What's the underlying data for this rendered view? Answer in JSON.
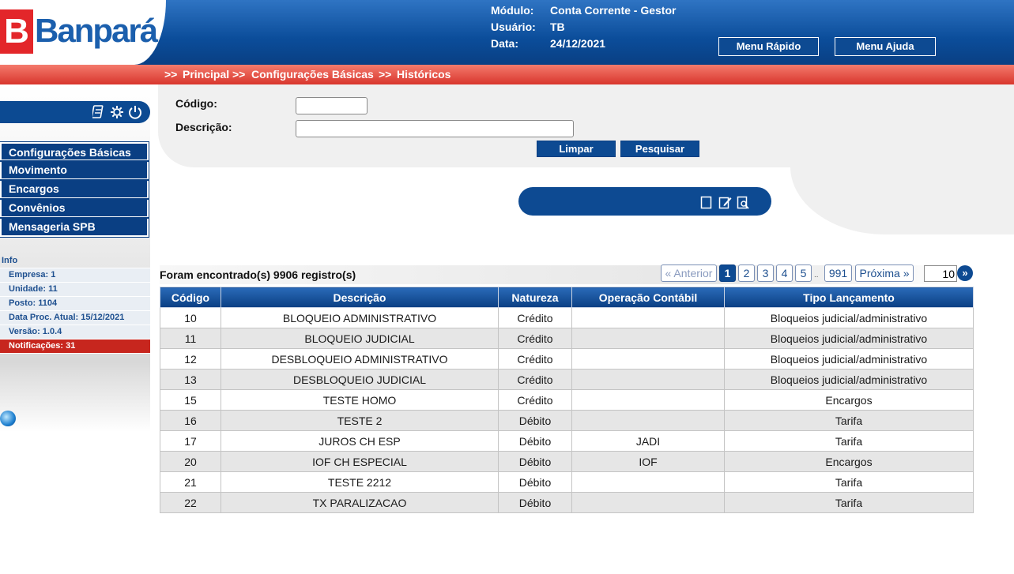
{
  "header": {
    "logo_text": "Banpará",
    "logo_mark": "B",
    "modulo_label": "Módulo:",
    "modulo_value": "Conta Corrente - Gestor",
    "usuario_label": "Usuário:",
    "usuario_value": "TB",
    "data_label": "Data:",
    "data_value": "24/12/2021",
    "menu_rapido": "Menu Rápido",
    "menu_ajuda": "Menu Ajuda"
  },
  "breadcrumb": {
    "sep": ">>",
    "items": [
      "Principal",
      "Configurações Básicas",
      "Históricos"
    ]
  },
  "sidebar": {
    "tools": [
      "calculator-icon",
      "gear-icon",
      "power-icon"
    ],
    "menu": [
      "Configurações Básicas",
      "Movimento",
      "Encargos",
      "Convênios",
      "Mensageria SPB"
    ],
    "info_title": "Info",
    "info": {
      "empresa": "Empresa: 1",
      "unidade": "Unidade: 11",
      "posto": "Posto: 1104",
      "data_proc": "Data Proc. Atual: 15/12/2021",
      "versao": "Versão: 1.0.4",
      "notificacoes": "Notificações: 31"
    }
  },
  "search": {
    "codigo_label": "Código:",
    "codigo_value": "",
    "descricao_label": "Descrição:",
    "descricao_value": "",
    "limpar": "Limpar",
    "pesquisar": "Pesquisar"
  },
  "actions": [
    "new-icon",
    "edit-icon",
    "view-icon"
  ],
  "results": {
    "count_text": "Foram encontrado(s) 9906 registro(s)",
    "pagination": {
      "prev": "« Anterior",
      "pages": [
        "1",
        "2",
        "3",
        "4",
        "5"
      ],
      "dots": "..",
      "last": "991",
      "next": "Próxima »",
      "current": "1",
      "page_size": "10",
      "go": "»"
    }
  },
  "table": {
    "headers": [
      "Código",
      "Descrição",
      "Natureza",
      "Operação Contábil",
      "Tipo Lançamento"
    ],
    "rows": [
      [
        "10",
        "BLOQUEIO ADMINISTRATIVO",
        "Crédito",
        "",
        "Bloqueios judicial/administrativo"
      ],
      [
        "11",
        "BLOQUEIO JUDICIAL",
        "Crédito",
        "",
        "Bloqueios judicial/administrativo"
      ],
      [
        "12",
        "DESBLOQUEIO ADMINISTRATIVO",
        "Crédito",
        "",
        "Bloqueios judicial/administrativo"
      ],
      [
        "13",
        "DESBLOQUEIO JUDICIAL",
        "Crédito",
        "",
        "Bloqueios judicial/administrativo"
      ],
      [
        "15",
        "TESTE HOMO",
        "Crédito",
        "",
        "Encargos"
      ],
      [
        "16",
        "TESTE 2",
        "Débito",
        "",
        "Tarifa"
      ],
      [
        "17",
        "JUROS CH ESP",
        "Débito",
        "JADI",
        "Tarifa"
      ],
      [
        "20",
        "IOF CH ESPECIAL",
        "Débito",
        "IOF",
        "Encargos"
      ],
      [
        "21",
        "TESTE 2212",
        "Débito",
        "",
        "Tarifa"
      ],
      [
        "22",
        "TX PARALIZACAO",
        "Débito",
        "",
        "Tarifa"
      ]
    ]
  },
  "colors": {
    "brand_blue": "#0d4a92",
    "brand_red": "#e3262a",
    "notification_red": "#c7261e"
  }
}
